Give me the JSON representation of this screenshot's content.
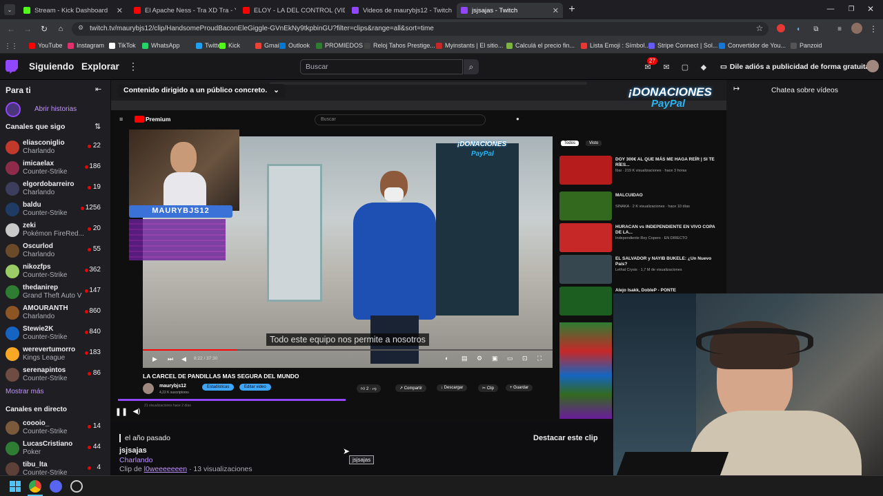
{
  "browser": {
    "tabs": [
      {
        "label": "Stream - Kick Dashboard",
        "color": "#53fc18",
        "active": false
      },
      {
        "label": "El Apache Ness - Tra XD Tra - Yo",
        "color": "#ff0000",
        "active": false
      },
      {
        "label": "ELOY - LA DEL CONTROL (VIDE",
        "color": "#ff0000",
        "active": false
      },
      {
        "label": "Videos de maurybjs12 - Twitch",
        "color": "#9147ff",
        "active": false
      },
      {
        "label": "jsjsajas - Twitch",
        "color": "#9147ff",
        "active": true
      }
    ],
    "url": "twitch.tv/maurybjs12/clip/HandsomeProudBaconEleGiggle-GVnEkNy9tkpbinGU?filter=clips&range=all&sort=time",
    "bookmarks": [
      {
        "label": "YouTube",
        "color": "#ff0000"
      },
      {
        "label": "Instagram",
        "color": "#e1306c"
      },
      {
        "label": "TikTok",
        "color": "#ffffff"
      },
      {
        "label": "WhatsApp",
        "color": "#25d366"
      },
      {
        "label": "Twitter",
        "color": "#1da1f2"
      },
      {
        "label": "Kick",
        "color": "#53fc18"
      },
      {
        "label": "Gmail",
        "color": "#ea4335"
      },
      {
        "label": "Outlook",
        "color": "#0078d4"
      },
      {
        "label": "PROMIEDOS",
        "color": "#2e7d32"
      },
      {
        "label": "Reloj Tahos Prestige...",
        "color": "#444444"
      },
      {
        "label": "Myinstants | El sitio...",
        "color": "#c62828"
      },
      {
        "label": "Calculá el precio fin...",
        "color": "#7cb342"
      },
      {
        "label": "Lista Emoji : Símbol...",
        "color": "#e53935"
      },
      {
        "label": "Stripe Connect | Sol...",
        "color": "#635bff"
      },
      {
        "label": "Convertidor de You...",
        "color": "#1976d2"
      },
      {
        "label": "Panzoid",
        "color": "#555555"
      }
    ]
  },
  "nav": {
    "following": "Siguiendo",
    "browse": "Explorar",
    "search_placeholder": "Buscar",
    "notif_count": "27",
    "ad_free": "Dile adiós a publicidad de forma gratuita"
  },
  "sidebar": {
    "for_you": "Para ti",
    "open_stories": "Abrir historias",
    "followed_header": "Canales que sigo",
    "followed": [
      {
        "name": "eliasconiglio",
        "game": "Charlando",
        "viewers": "22",
        "color": "#c0392b"
      },
      {
        "name": "imicaelax",
        "game": "Counter-Strike",
        "viewers": "186",
        "color": "#8e2b4b"
      },
      {
        "name": "elgordobarreiro",
        "game": "Charlando",
        "viewers": "19",
        "color": "#3d3d5c"
      },
      {
        "name": "baldu",
        "game": "Counter-Strike",
        "viewers": "1256",
        "color": "#1f3b63"
      },
      {
        "name": "zeki",
        "game": "Pokémon FireRed...",
        "viewers": "20",
        "color": "#c9c9c9"
      },
      {
        "name": "Oscurlod",
        "game": "Charlando",
        "viewers": "55",
        "color": "#6b4a2a"
      },
      {
        "name": "nikozfps",
        "game": "Counter-Strike",
        "viewers": "362",
        "color": "#9ccc65"
      },
      {
        "name": "thedanirep",
        "game": "Grand Theft Auto V",
        "viewers": "147",
        "color": "#2e7d32"
      },
      {
        "name": "AMOURANTH",
        "game": "Charlando",
        "viewers": "860",
        "color": "#8d5524"
      },
      {
        "name": "Stewie2K",
        "game": "Counter-Strike",
        "viewers": "840",
        "color": "#1565c0"
      },
      {
        "name": "werevertumorro",
        "game": "Kings League",
        "viewers": "183",
        "color": "#f9a825"
      },
      {
        "name": "serenapintos",
        "game": "Counter-Strike",
        "viewers": "86",
        "color": "#6d4c41"
      }
    ],
    "show_more": "Mostrar más",
    "live_header": "Canales en directo",
    "live": [
      {
        "name": "coooio_",
        "game": "Counter-Strike",
        "viewers": "14",
        "color": "#7b5a3c"
      },
      {
        "name": "LucasCristiano",
        "game": "Poker",
        "viewers": "44",
        "color": "#2e7d32"
      },
      {
        "name": "tibu_lta",
        "game": "Counter-Strike",
        "viewers": "4",
        "color": "#5d4037"
      }
    ]
  },
  "video": {
    "audience_banner": "Contenido dirigido a un público concreto.",
    "donaciones": "¡DONACIONES",
    "paypal": "PayPal",
    "yt_search": "Buscar",
    "yt_premium": "Premium",
    "inner_tabs": [
      "Todos",
      "Visto"
    ],
    "streamer_overlay": "MAURYBJS12",
    "subtitle": "Todo este equipo nos permite a nosotros",
    "yt_time": "8:22 / 37:30",
    "yt_title": "LA CARCEL DE PANDILLAS MAS SEGURA DEL MUNDO",
    "yt_channel": "maurybjs12",
    "yt_subs": "4,22 K suscriptores",
    "yt_stats_btn": "Estadísticas",
    "yt_edit_btn": "Editar video",
    "yt_likes": "2",
    "yt_share": "Compartir",
    "yt_download": "Descargar",
    "yt_clip": "Clip",
    "yt_save": "Guardar",
    "yt_views": "21 visualizaciones hace 2 días",
    "recommended": [
      {
        "title": "DOY 300€ AL QUE MÁS ME HAGA REÍR | SI TE RÍES...",
        "meta": "Ibai · 219 K visualizaciones · hace 3 horas",
        "color": "#b71c1c"
      },
      {
        "title": "MALCUIDAO",
        "meta": "SINAKA · 2 K visualizaciones · hace 10 días",
        "color": "#33691e"
      },
      {
        "title": "HURACAN vs INDEPENDIENTE EN VIVO COPA DE LA...",
        "meta": "Independiente Rey Copero · EN DIRECTO",
        "color": "#c62828"
      },
      {
        "title": "EL SALVADOR y NAYIB BUKELE: ¿Un Nuevo País?",
        "meta": "Lethal Crysis · 1,7 M de visualizaciones",
        "color": "#37474f"
      },
      {
        "title": "Alejo Isakk, DobleP - PONTE",
        "meta": "",
        "color": "#1b5e20"
      }
    ]
  },
  "clip": {
    "date": "el año pasado",
    "title": "jsjsajas",
    "category": "Charlando",
    "clip_by_prefix": "Clip de",
    "clip_by": "l0weeeeeeen",
    "views": "· 13 visualizaciones",
    "highlight_btn": "Destacar este clip",
    "tooltip": "jsjsajas"
  },
  "chat": {
    "title": "Chatea sobre vídeos"
  }
}
